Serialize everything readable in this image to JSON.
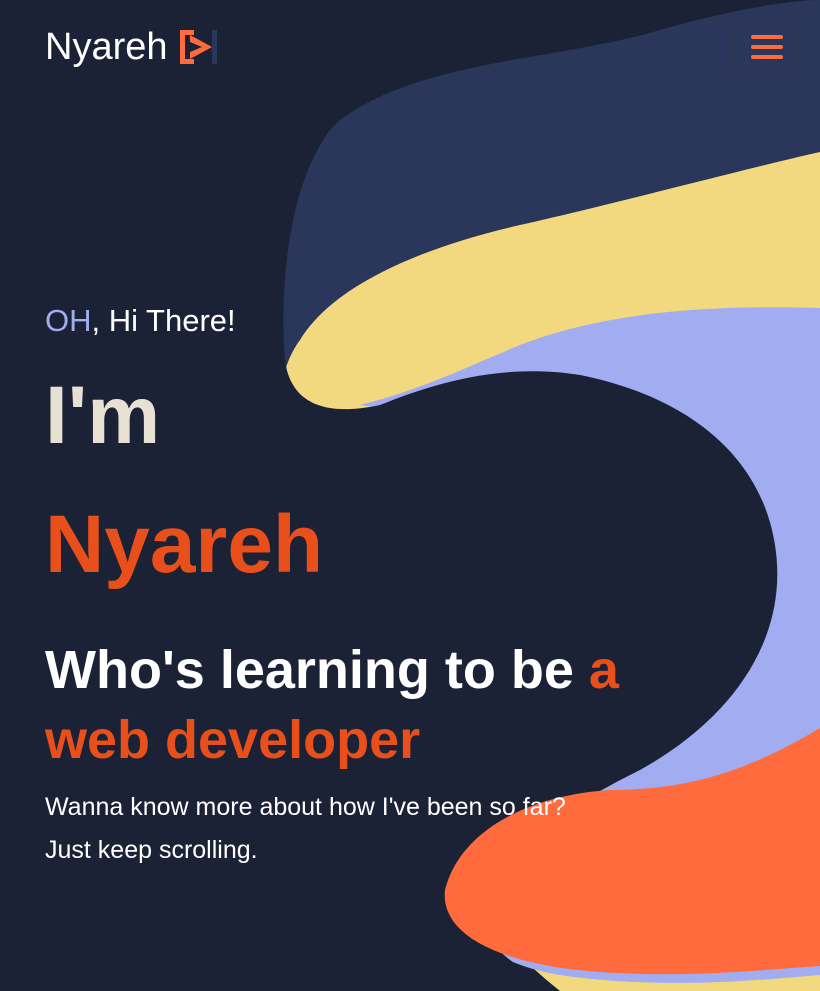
{
  "header": {
    "brand_name": "Nyareh",
    "logo_icon": "play-bracket-logo-icon",
    "menu_icon": "hamburger-menu-icon"
  },
  "hero": {
    "greeting_accent": "OH",
    "greeting_rest": ", Hi There!",
    "im": "I'm",
    "name": "Nyareh",
    "headline_main": "Who's learning to be ",
    "headline_accent": "a web developer",
    "subtext_line1": "Wanna know more about how I've been so far?",
    "subtext_line2": "Just keep scrolling."
  },
  "colors": {
    "background": "#1c2235",
    "navy_blob": "#2b375a",
    "yellow_blob": "#f2d980",
    "lavender_blob": "#a1acf1",
    "orange_blob": "#ff6b3d",
    "accent_text": "#e94f1a",
    "greeting_accent": "#a1acf1"
  }
}
